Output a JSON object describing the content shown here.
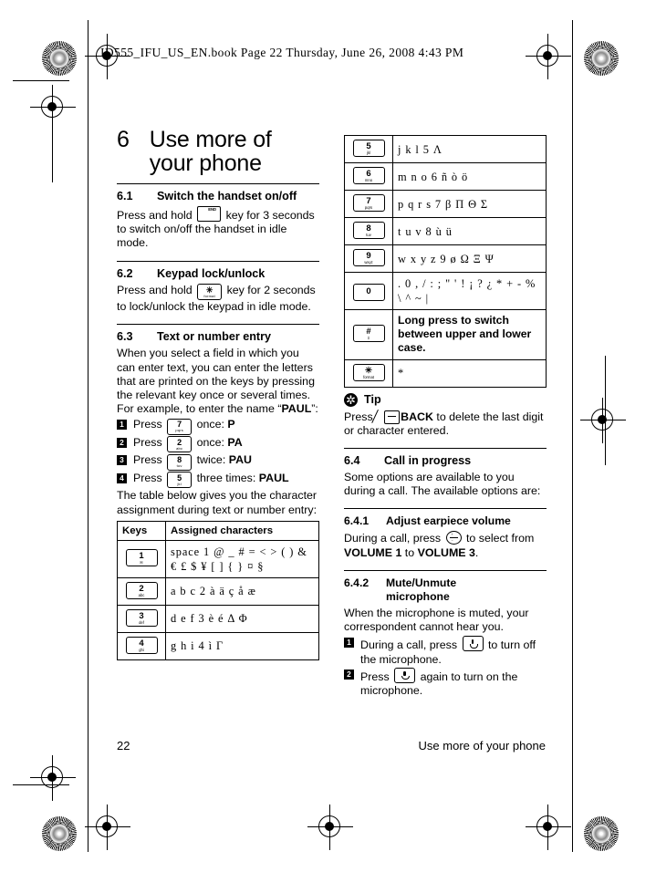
{
  "running_head": "ID555_IFU_US_EN.book  Page 22  Thursday, June 26, 2008  4:43 PM",
  "chapter": {
    "number": "6",
    "title": "Use more of your phone"
  },
  "sections": {
    "s61": {
      "number": "6.1",
      "title": "Switch the handset on/off",
      "body_before": "Press and hold",
      "body_after": "key for 3 seconds to switch on/off the handset in idle mode.",
      "key_label": "END"
    },
    "s62": {
      "number": "6.2",
      "title": "Keypad lock/unlock",
      "body_before": "Press and hold",
      "body_after": "key for 2 seconds to lock/unlock the keypad in idle mode.",
      "key_digit": "✳",
      "key_sub": "format"
    },
    "s63": {
      "number": "6.3",
      "title": "Text or number entry",
      "intro": "When you select a field in which you can enter text, you can enter the letters that are printed on the keys by pressing the relevant key once or several times. For example, to enter the name “",
      "intro_bold": "PAUL",
      "intro_end": "”:",
      "steps": [
        {
          "index": "1",
          "before": "Press",
          "key": "7",
          "key_sub": "pqrs",
          "after": "once: ",
          "result": "P"
        },
        {
          "index": "2",
          "before": "Press",
          "key": "2",
          "key_sub": "abc",
          "after": "once: ",
          "result": "PA"
        },
        {
          "index": "3",
          "before": "Press",
          "key": "8",
          "key_sub": "tuv",
          "after": "twice: ",
          "result": "PAU"
        },
        {
          "index": "4",
          "before": "Press",
          "key": "5",
          "key_sub": "jkl",
          "after": "three times: ",
          "result": "PAUL"
        }
      ],
      "outro": "The table below gives you the character assignment during text or number entry:"
    },
    "s64": {
      "number": "6.4",
      "title": "Call in progress",
      "body": "Some options are available to you during a call. The available options are:"
    },
    "s641": {
      "number": "6.4.1",
      "title": "Adjust earpiece volume",
      "before": "During a call, press",
      "mid": "to select from ",
      "vol_from": "VOLUME 1",
      "to": " to ",
      "vol_to": "VOLUME 3",
      "end": "."
    },
    "s642": {
      "number": "6.4.2",
      "title_line1": "Mute/Unmute",
      "title_line2": "microphone",
      "body": "When the microphone is muted, your correspondent cannot hear you.",
      "steps": [
        {
          "index": "1",
          "before": "During a call, press",
          "after": "to turn off the microphone."
        },
        {
          "index": "2",
          "before": "Press",
          "after": "again to turn on the microphone."
        }
      ]
    }
  },
  "tip": {
    "icon": "asterisk-icon",
    "label": "Tip",
    "before": "Press",
    "bold": "BACK",
    "after": "to delete the last digit or character entered."
  },
  "key_table": {
    "headers": {
      "keys": "Keys",
      "characters": "Assigned characters"
    },
    "rows_left": [
      {
        "digit": "1",
        "sub": "✉",
        "chars": "space 1 @ _ # = < > ( ) & € £ $ ¥ [ ] { } ¤ §",
        "sans": false
      },
      {
        "digit": "2",
        "sub": "abc",
        "chars": "a b c 2 à ä ç å æ",
        "sans": false
      },
      {
        "digit": "3",
        "sub": "def",
        "chars": "d e f 3 è é Δ Φ",
        "sans": false
      },
      {
        "digit": "4",
        "sub": "ghi",
        "chars": "g h i 4 ì Γ",
        "sans": false
      }
    ],
    "rows_right": [
      {
        "digit": "5",
        "sub": "jkl",
        "chars": "j k l 5 Λ",
        "sans": false
      },
      {
        "digit": "6",
        "sub": "mno",
        "chars": "m n o 6 ñ ò ö",
        "sans": false
      },
      {
        "digit": "7",
        "sub": "pqrs",
        "chars": "p q r s 7 β Π Θ Σ",
        "sans": false
      },
      {
        "digit": "8",
        "sub": "tuv",
        "chars": "t u v 8 ù ü",
        "sans": false
      },
      {
        "digit": "9",
        "sub": "wxyz",
        "chars": "w x y z 9 ø Ω Ξ Ψ",
        "sans": false
      },
      {
        "digit": "0",
        "sub": "",
        "chars": ". 0 , / : ; \" ' ! ¡ ? ¿ * + - % \\ ^ ~ |",
        "sans": false
      },
      {
        "digit": "#",
        "sub": "⇕",
        "chars": "Long press to switch between upper and lower case.",
        "sans": true
      },
      {
        "digit": "✳",
        "sub": "format",
        "chars": "*",
        "sans": false
      }
    ]
  },
  "footer": {
    "page_number": "22",
    "running_title": "Use more of your phone"
  }
}
